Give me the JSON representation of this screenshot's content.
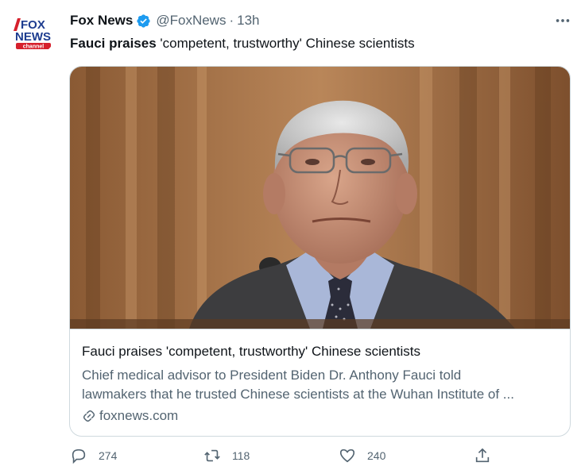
{
  "tweet": {
    "author_name": "Fox News",
    "handle": "@FoxNews",
    "separator": "·",
    "time": "13h",
    "text_bold": "Fauci praises",
    "text_rest": " 'competent, trustworthy' Chinese scientists",
    "more_icon": "more-horizontal-icon"
  },
  "avatar": {
    "line1": "FOX",
    "line2": "NEWS",
    "line3": "channel",
    "brand_blue": "#1d3c8f",
    "brand_red": "#d6202c"
  },
  "card": {
    "title": "Fauci praises 'competent, trustworthy' Chinese scientists",
    "description_line1": "Chief medical advisor to President Biden Dr. Anthony Fauci told",
    "description_line2": "lawmakers that he trusted Chinese scientists at the Wuhan Institute of ...",
    "domain": "foxnews.com",
    "link_icon": "link-icon"
  },
  "actions": {
    "reply_count": "274",
    "retweet_count": "118",
    "like_count": "240",
    "share_icon": "share-icon"
  },
  "colors": {
    "text_primary": "#0f1419",
    "text_secondary": "#536471",
    "verified_blue": "#1d9bf0",
    "border": "#cfd9de"
  }
}
